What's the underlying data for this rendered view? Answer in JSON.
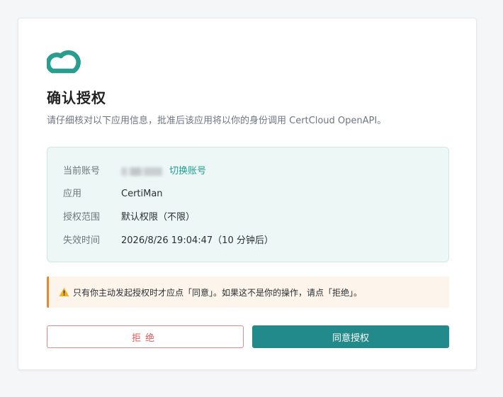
{
  "logo": {
    "icon": "cloud-logo-icon",
    "color": "#2a9d8f"
  },
  "header": {
    "title": "确认授权",
    "subtitle": "请仔细核对以下应用信息，批准后该应用将以你的身份调用 CertCloud OpenAPI。"
  },
  "info": {
    "account": {
      "label": "当前账号",
      "switch_label": "切换账号"
    },
    "app": {
      "label": "应用",
      "value": "CertiMan"
    },
    "scope": {
      "label": "授权范围",
      "value": "默认权限（不限）"
    },
    "expiry": {
      "label": "失效时间",
      "value": "2026/8/26 19:04:47（10 分钟后）"
    }
  },
  "warning": {
    "icon": "warning-icon",
    "text": "只有你主动发起授权时才应点「同意」。如果这不是你的操作，请点「拒绝」。"
  },
  "buttons": {
    "reject_label": "拒绝",
    "approve_label": "同意授权"
  },
  "colors": {
    "accent": "#228a8b",
    "link": "#1f9f95",
    "danger": "#e05757",
    "warning": "#e6892f"
  }
}
